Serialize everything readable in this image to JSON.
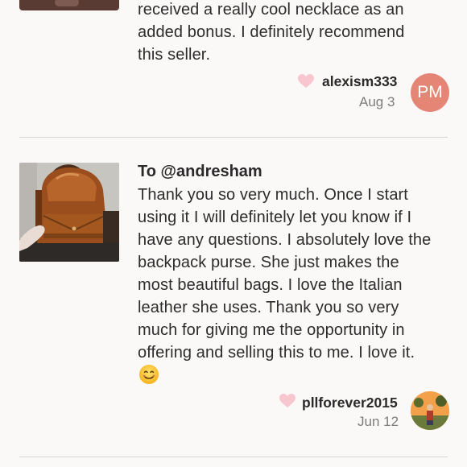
{
  "reviews": [
    {
      "text_lines": [
        "received a really cool necklace as an",
        "added bonus. I definitely recommend",
        "this seller."
      ],
      "username": "alexism333",
      "date": "Aug 3",
      "avatar_initials": "PM",
      "avatar_color": "#e58576"
    },
    {
      "addressee": "To @andresham",
      "text_lines": [
        "Thank you so very much. Once I start",
        "using it I will definitely let you know if I",
        "have any questions. I absolutely love the",
        "backpack purse. She just makes the",
        "most beautiful bags. I love the Italian",
        "leather she uses. Thank you so very",
        "much for giving me the opportunity in",
        "offering and selling this to me. I love it."
      ],
      "emoji": "smiling-face-emoji",
      "username": "pllforever2015",
      "date": "Jun 12"
    }
  ],
  "colors": {
    "background": "#fbf8f8",
    "heart": "#f7c6cf",
    "divider": "#d9d5d5"
  },
  "icons": {
    "like": "heart-icon"
  }
}
